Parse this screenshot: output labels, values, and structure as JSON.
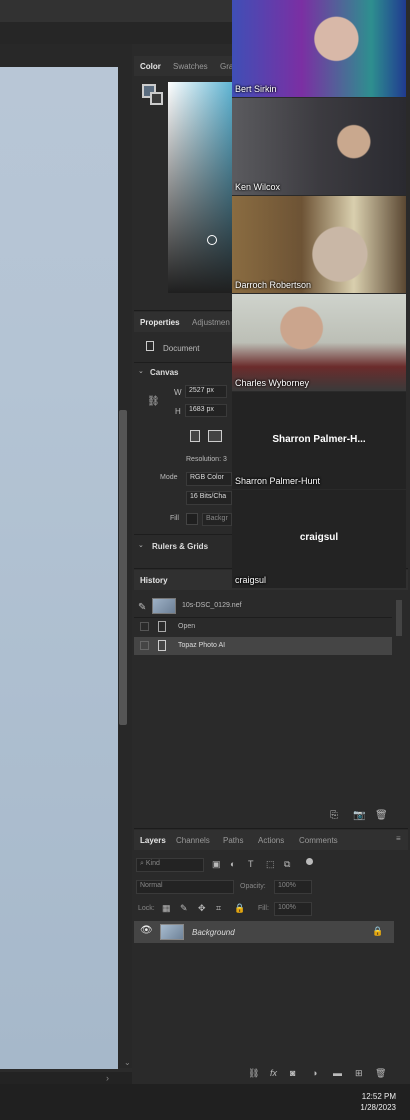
{
  "photoshop": {
    "color_panel": {
      "tabs": [
        "Color",
        "Swatches",
        "Gra"
      ]
    },
    "properties_panel": {
      "tabs": [
        "Properties",
        "Adjustmen"
      ],
      "document_label": "Document",
      "canvas_section": "Canvas",
      "width_label": "W",
      "width_value": "2527 px",
      "height_label": "H",
      "height_value": "1683 px",
      "resolution_label": "Resolution: 3",
      "mode_label": "Mode",
      "mode_value": "RGB Color",
      "bits_value": "16 Bits/Cha",
      "fill_label": "Fill",
      "fill_value": "Backgr",
      "rulers_section": "Rulers & Grids"
    },
    "history_panel": {
      "tab": "History",
      "snapshot_name": "10s-DSC_0129.nef",
      "items": [
        "Open",
        "Topaz Photo AI"
      ]
    },
    "layers_panel": {
      "tabs": [
        "Layers",
        "Channels",
        "Paths",
        "Actions",
        "Comments"
      ],
      "kind_label": "Kind",
      "blend_mode": "Normal",
      "opacity_label": "Opacity:",
      "opacity_value": "100%",
      "lock_label": "Lock:",
      "fill_label": "Fill:",
      "fill_value": "100%",
      "layer_name": "Background"
    }
  },
  "zoom": {
    "participants": [
      {
        "name": "Bert Sirkin"
      },
      {
        "name": "Ken Wilcox"
      },
      {
        "name": "Darroch Robertson"
      },
      {
        "name": "Charles Wyborney"
      },
      {
        "name": "Sharron Palmer-Hunt",
        "center_label": "Sharron  Palmer-H..."
      },
      {
        "name": "craigsul",
        "center_label": "craigsul"
      }
    ]
  },
  "taskbar": {
    "time": "12:52 PM",
    "date": "1/28/2023"
  },
  "colors": {
    "accent": "#2d2d2d",
    "photo": "#b4c4d4"
  }
}
